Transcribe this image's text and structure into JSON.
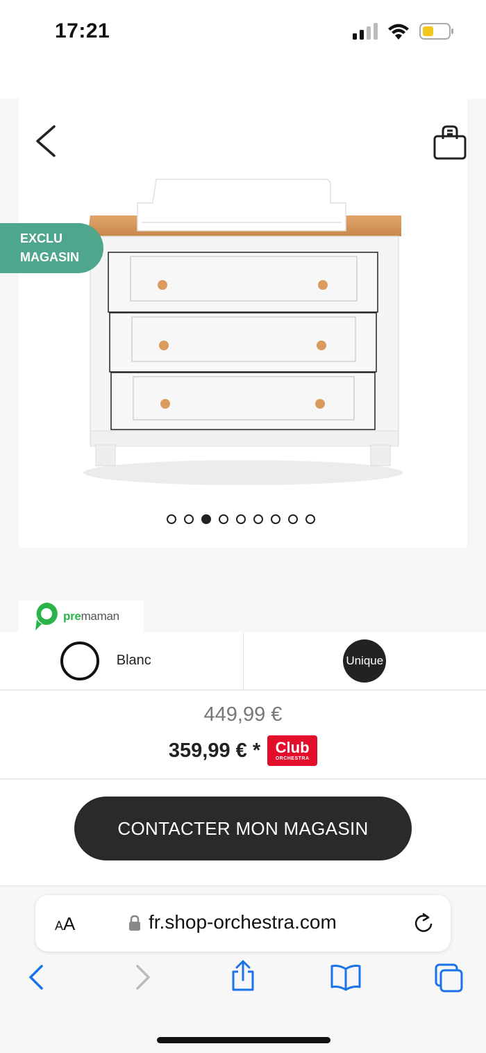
{
  "status_bar": {
    "time": "17:21",
    "icons": [
      "signal-icon",
      "wifi-icon",
      "battery-icon"
    ]
  },
  "product": {
    "badge_line1": "EXCLU",
    "badge_line2": "MAGASIN",
    "image_description_icon": "changing-dresser-image",
    "gallery_dots_count": 9,
    "gallery_active_index": 2,
    "brand": {
      "prefix": "pre",
      "suffix": "maman"
    },
    "color": {
      "label": "Blanc",
      "swatch_color": "#ffffff"
    },
    "size": {
      "label": "Unique"
    },
    "old_price": "449,99 €",
    "new_price": "359,99 € *",
    "club_badge": {
      "line1": "Club",
      "line2": "ORCHESTRA",
      "color": "#e30d2c"
    }
  },
  "cta": {
    "label": "CONTACTER MON MAGASIN"
  },
  "browser": {
    "aa_label_small": "A",
    "aa_label_big": "A",
    "url": "fr.shop-orchestra.com",
    "toolbar_icons": [
      "back-icon",
      "forward-icon",
      "share-icon",
      "bookmarks-icon",
      "tabs-icon"
    ]
  },
  "colors": {
    "accent_badge": "#4ea68c",
    "cta_bg": "#2a2a2a",
    "ios_blue": "#1a73e8"
  }
}
